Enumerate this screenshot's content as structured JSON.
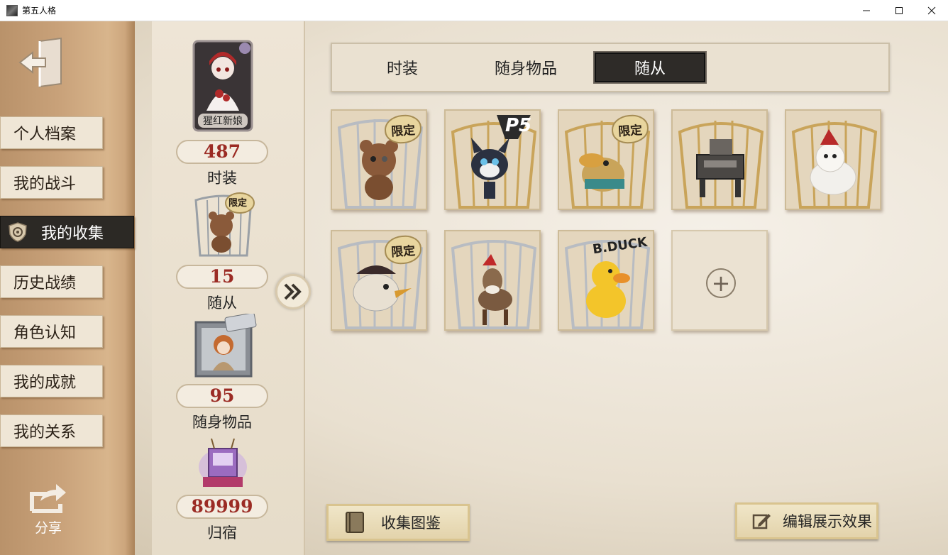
{
  "window": {
    "title": "第五人格",
    "minimize": "—",
    "maximize": "☐",
    "close": "✕"
  },
  "nav": {
    "items": [
      {
        "label": "个人档案",
        "active": false
      },
      {
        "label": "我的战斗",
        "active": false
      },
      {
        "label": "我的收集",
        "active": true
      },
      {
        "label": "历史战绩",
        "active": false
      },
      {
        "label": "角色认知",
        "active": false
      },
      {
        "label": "我的成就",
        "active": false
      },
      {
        "label": "我的关系",
        "active": false
      }
    ],
    "share_label": "分享"
  },
  "stats": [
    {
      "icon": "costume-portrait",
      "badge": "猩红新娘",
      "count": "487",
      "label": "时装"
    },
    {
      "icon": "pet-bear",
      "badge": "限定",
      "count": "15",
      "label": "随从"
    },
    {
      "icon": "accessory-doll",
      "badge": "",
      "count": "95",
      "label": "随身物品"
    },
    {
      "icon": "home-item",
      "badge": "",
      "count": "89999",
      "label": "归宿"
    }
  ],
  "tabs": [
    {
      "label": "时装",
      "active": false
    },
    {
      "label": "随身物品",
      "active": false
    },
    {
      "label": "随从",
      "active": true
    }
  ],
  "pets": [
    {
      "name": "teddy-bear",
      "badge": "限定",
      "color": "#8a5a3a"
    },
    {
      "name": "persona5-cat",
      "badge": "P5",
      "color": "#2b3140"
    },
    {
      "name": "platypus",
      "badge": "限定",
      "color": "#c9a45a"
    },
    {
      "name": "robot-dog",
      "badge": "",
      "color": "#4a4744"
    },
    {
      "name": "white-dog",
      "badge": "",
      "color": "#f2f0ec"
    },
    {
      "name": "pirate-bird",
      "badge": "限定",
      "color": "#e8e0d2"
    },
    {
      "name": "reindeer",
      "badge": "",
      "color": "#7a5a40"
    },
    {
      "name": "b-duck",
      "badge": "B.DUCK",
      "color": "#f3c52a"
    }
  ],
  "add_slot": "+",
  "buttons": {
    "catalog": "收集图鉴",
    "edit": "编辑展示效果"
  },
  "colors": {
    "count_red": "#9b2b24",
    "active_dark": "#2c2925",
    "paper": "#eae1d1"
  }
}
